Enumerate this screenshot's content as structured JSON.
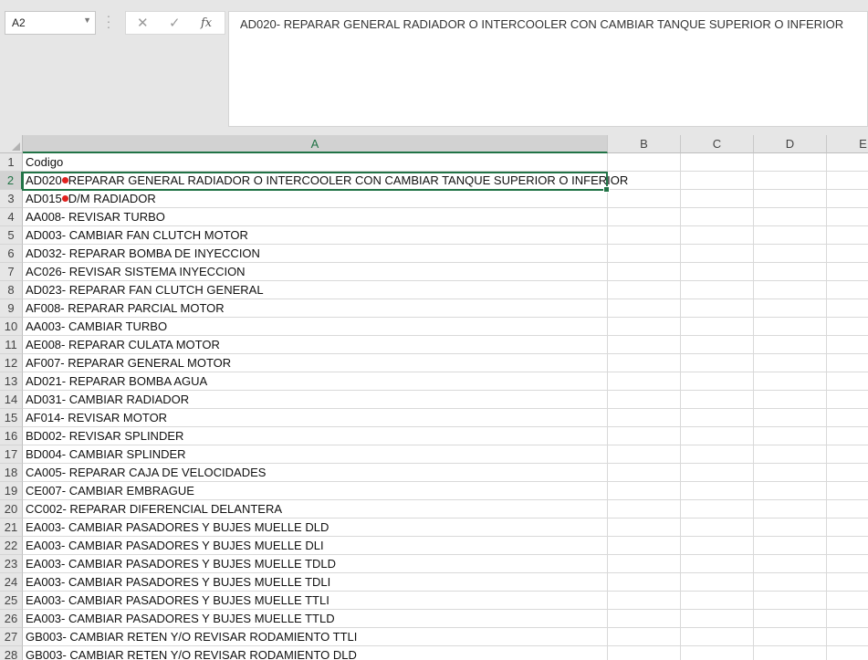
{
  "name_box": {
    "value": "A2"
  },
  "formula_bar": {
    "fx_label": "fx",
    "value": "AD020- REPARAR GENERAL RADIADOR O INTERCOOLER CON CAMBIAR TANQUE SUPERIOR O INFERIOR"
  },
  "columns": [
    "A",
    "B",
    "C",
    "D",
    "E"
  ],
  "rows": [
    {
      "num": "1",
      "a": "Codigo"
    },
    {
      "num": "2",
      "code": "AD020",
      "rest": "REPARAR GENERAL RADIADOR O INTERCOOLER CON CAMBIAR TANQUE SUPERIOR O INFERIOR"
    },
    {
      "num": "3",
      "code": "AD015",
      "rest": "D/M RADIADOR"
    },
    {
      "num": "4",
      "a": "AA008- REVISAR  TURBO"
    },
    {
      "num": "5",
      "a": "AD003- CAMBIAR FAN CLUTCH MOTOR"
    },
    {
      "num": "6",
      "a": "AD032- REPARAR BOMBA DE INYECCION"
    },
    {
      "num": "7",
      "a": "AC026- REVISAR SISTEMA INYECCION"
    },
    {
      "num": "8",
      "a": "AD023- REPARAR FAN CLUTCH GENERAL"
    },
    {
      "num": "9",
      "a": "AF008- REPARAR PARCIAL MOTOR"
    },
    {
      "num": "10",
      "a": "AA003- CAMBIAR TURBO"
    },
    {
      "num": "11",
      "a": "AE008- REPARAR CULATA MOTOR"
    },
    {
      "num": "12",
      "a": "AF007- REPARAR GENERAL MOTOR"
    },
    {
      "num": "13",
      "a": "AD021- REPARAR  BOMBA AGUA"
    },
    {
      "num": "14",
      "a": "AD031- CAMBIAR RADIADOR"
    },
    {
      "num": "15",
      "a": "AF014- REVISAR MOTOR"
    },
    {
      "num": "16",
      "a": "BD002- REVISAR SPLINDER"
    },
    {
      "num": "17",
      "a": "BD004- CAMBIAR SPLINDER"
    },
    {
      "num": "18",
      "a": "CA005- REPARAR CAJA DE VELOCIDADES"
    },
    {
      "num": "19",
      "a": "CE007- CAMBIAR EMBRAGUE"
    },
    {
      "num": "20",
      "a": "CC002- REPARAR DIFERENCIAL DELANTERA"
    },
    {
      "num": "21",
      "a": "EA003- CAMBIAR PASADORES Y BUJES MUELLE DLD"
    },
    {
      "num": "22",
      "a": "EA003- CAMBIAR PASADORES Y BUJES MUELLE DLI"
    },
    {
      "num": "23",
      "a": "EA003- CAMBIAR PASADORES Y BUJES MUELLE TDLD"
    },
    {
      "num": "24",
      "a": "EA003- CAMBIAR PASADORES Y BUJES MUELLE TDLI"
    },
    {
      "num": "25",
      "a": "EA003- CAMBIAR PASADORES Y BUJES MUELLE TTLI"
    },
    {
      "num": "26",
      "a": "EA003- CAMBIAR PASADORES Y BUJES MUELLE TTLD"
    },
    {
      "num": "27",
      "a": "GB003- CAMBIAR RETEN  Y/O REVISAR RODAMIENTO TTLI"
    },
    {
      "num": "28",
      "a": "GB003- CAMBIAR RETEN  Y/O REVISAR RODAMIENTO DLD"
    }
  ],
  "colors": {
    "accent": "#217346",
    "red_marker": "#e0221f"
  }
}
